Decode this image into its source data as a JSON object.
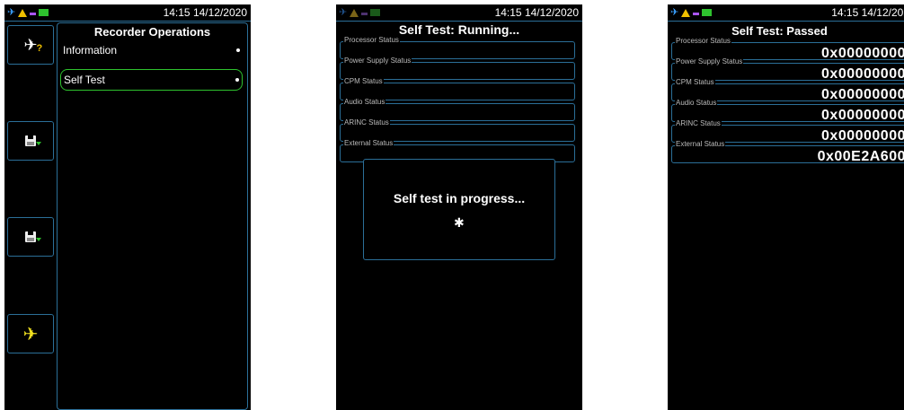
{
  "status_bar": {
    "time": "14:15 14/12/2020",
    "time_cut": "14:15 14/12/202"
  },
  "screen1": {
    "title": "Recorder Operations",
    "items": [
      {
        "label": "Information",
        "selected": false
      },
      {
        "label": "Self Test",
        "selected": true
      }
    ],
    "side_icons": [
      "plane-question-icon",
      "save-download-icon",
      "save-download-icon",
      "plane-icon"
    ]
  },
  "screen2": {
    "title": "Self Test: Running...",
    "fields": [
      "Processor Status",
      "Power Supply Status",
      "CPM Status",
      "Audio Status",
      "ARINC Status",
      "External Status"
    ],
    "dialog_text": "Self test in progress..."
  },
  "screen3": {
    "title": "Self Test: Passed",
    "fields": [
      {
        "label": "Processor Status",
        "value": "0x00000000"
      },
      {
        "label": "Power Supply Status",
        "value": "0x00000000"
      },
      {
        "label": "CPM Status",
        "value": "0x00000000"
      },
      {
        "label": "Audio Status",
        "value": "0x00000000"
      },
      {
        "label": "ARINC Status",
        "value": "0x00000000"
      },
      {
        "label": "External Status",
        "value": "0x00E2A600"
      }
    ]
  },
  "colors": {
    "accent_border": "#2b6f98",
    "selected_border": "#2ec22e",
    "warning": "#f0c000"
  }
}
